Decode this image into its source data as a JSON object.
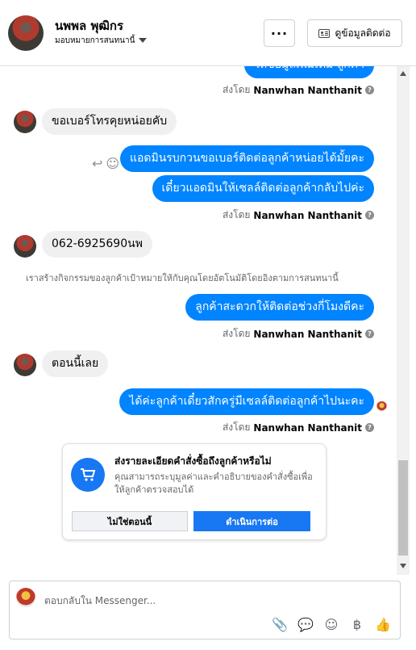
{
  "header": {
    "name": "นพพล พุฒิกร",
    "assign_label": "มอบหมายการสนทนานี้",
    "more_label": "···",
    "contact_info_label": "ดูข้อมูลติดต่อ"
  },
  "thread": {
    "messages": [
      {
        "id": "m0",
        "text": "ให้ข้อมูลเพิ่มเติม ลูกค้า"
      },
      {
        "id": "m1",
        "text": "ขอเบอร์โทรคุยหน่อยคับ"
      },
      {
        "id": "m2",
        "text": "แอดมินรบกวนขอเบอร์ติดต่อลูกค้าหน่อยได้มั้ยคะ"
      },
      {
        "id": "m3",
        "text": "เดี๋ยวแอดมินให้เซลล์ติดต่อลูกค้ากลับไปค่ะ"
      },
      {
        "id": "m4",
        "text": "062-6925690นพ"
      },
      {
        "id": "m5",
        "text": "ลูกค้าสะดวกให้ติดต่อช่วงกี่โมงดีคะ"
      },
      {
        "id": "m6",
        "text": "ตอนนี้เลย"
      },
      {
        "id": "m7",
        "text": "ได้ค่ะลูกค้าเดี๋ยวสักครู่มีเซลล์ติดต่อลูกค้าไปนะคะ"
      }
    ],
    "sent_by_prefix": "ส่งโดย",
    "sender_name": "Nanwhan Nanthanit",
    "system_note": "เราสร้างกิจกรรมของลูกค้าเป้าหมายให้กับคุณโดยอัตโนมัติโดยอิงตามการสนทนานี้",
    "help_icon": "?"
  },
  "order_card": {
    "title": "ส่งรายละเอียดคำสั่งซื้อถึงลูกค้าหรือไม่",
    "description": "คุณสามารถระบุมูลค่าและคำอธิบายของคำสั่งซื้อเพื่อให้ลูกค้าตรวจสอบได้",
    "no_label": "ไม่ใช่ตอนนี้",
    "yes_label": "ดำเนินการต่อ"
  },
  "composer": {
    "placeholder": "ตอบกลับใน Messenger...",
    "tools": [
      "attach-icon",
      "chat-icon",
      "emoji-icon",
      "baht-icon",
      "like-icon"
    ]
  },
  "colors": {
    "outgoing": "#0084ff",
    "incoming": "#f0f0f0",
    "accent": "#1877f2"
  }
}
